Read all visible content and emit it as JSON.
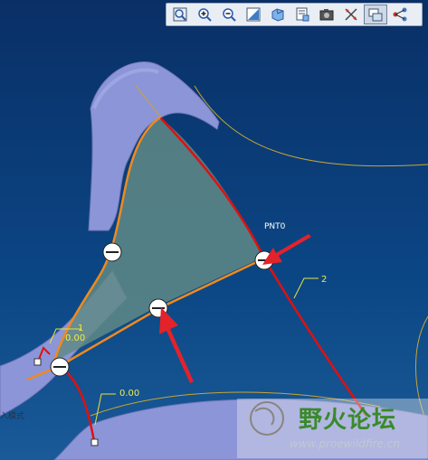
{
  "toolbar": {
    "buttons": [
      {
        "icon": "zoom-fit-icon"
      },
      {
        "icon": "zoom-in-icon"
      },
      {
        "icon": "zoom-out-icon"
      },
      {
        "icon": "repaint-icon"
      },
      {
        "icon": "display-style-icon"
      },
      {
        "icon": "saved-views-icon"
      },
      {
        "icon": "camera-icon"
      },
      {
        "icon": "datum-points-toggle-icon"
      },
      {
        "icon": "datum-planes-toggle-icon",
        "active": true
      },
      {
        "icon": "point-connect-icon"
      }
    ]
  },
  "canvas": {
    "dimension_labels": {
      "top_left_value": "0.00",
      "top_left_index": "1",
      "bottom_value": "0.00",
      "right_index": "2",
      "point_name": "PNT0"
    },
    "side_text": "入模式"
  },
  "watermark": {
    "title": "野火论坛",
    "url": "www.proewildfire.cn"
  },
  "colors": {
    "background_top": "#0a2f66",
    "surface": "#8c95d8",
    "boundary_red": "#e01010",
    "boundary_orange": "#f08a1c",
    "fill_surface": "#5f8a86",
    "arrow_red": "#e4222a"
  }
}
